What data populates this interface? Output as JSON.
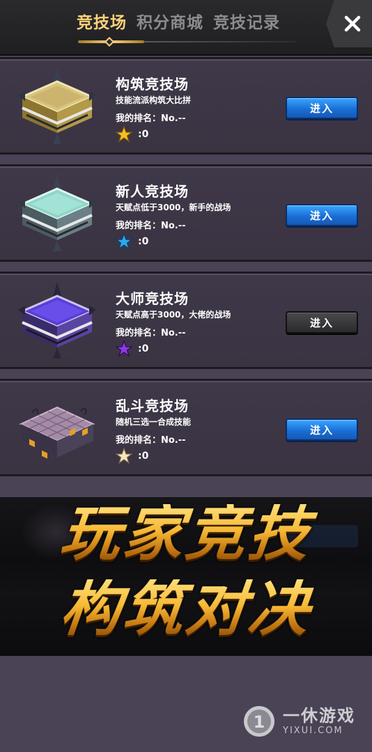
{
  "header": {
    "tabs": [
      {
        "label": "竞技场",
        "active": true
      },
      {
        "label": "积分商城",
        "active": false
      },
      {
        "label": "竞技记录",
        "active": false
      }
    ],
    "close_icon": "close-icon"
  },
  "arenas": [
    {
      "title": "构筑竞技场",
      "desc": "技能流派构筑大比拼",
      "rank": "我的排名：No.--",
      "stars": ":0",
      "star_color": "#f4c21e",
      "icon": "gold-arena-icon",
      "enter": "进入",
      "enter_style": "blue"
    },
    {
      "title": "新人竞技场",
      "desc": "天赋点低于3000，新手的战场",
      "rank": "我的排名：No.--",
      "stars": ":0",
      "star_color": "#2fa8e8",
      "icon": "teal-arena-icon",
      "enter": "进入",
      "enter_style": "blue"
    },
    {
      "title": "大师竞技场",
      "desc": "天赋点高于3000，大佬的战场",
      "rank": "我的排名：No.--",
      "stars": ":0",
      "star_color": "#8a3ae0",
      "icon": "purple-arena-icon",
      "enter": "进入",
      "enter_style": "dark"
    },
    {
      "title": "乱斗竞技场",
      "desc": "随机三选一合成技能",
      "rank": "我的排名：No.--",
      "stars": ":0",
      "star_color": "#f6e6c0",
      "icon": "stone-arena-icon",
      "enter": "进入",
      "enter_style": "blue"
    }
  ],
  "banner": {
    "line1": "玩家竞技",
    "line2": "构筑对决"
  },
  "watermark": {
    "name": "一休游戏",
    "url": "YIXUI.COM",
    "logo_digit": "1"
  }
}
